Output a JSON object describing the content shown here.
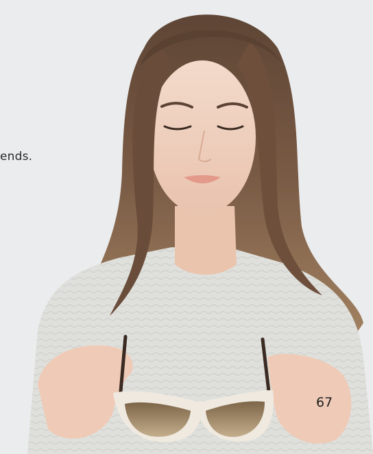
{
  "page": {
    "body_text_fragment": "ends.",
    "page_number": "67"
  },
  "photo": {
    "subject": "woman-holding-sunglasses",
    "colors": {
      "background": "#ebeced",
      "hair": "#6b4f3c",
      "skin": "#f1d2c0",
      "sweater": "#dfe0dc",
      "sunglass_frame": "#efe9df",
      "lens": "#a9916c",
      "lips": "#e39a8b"
    }
  }
}
